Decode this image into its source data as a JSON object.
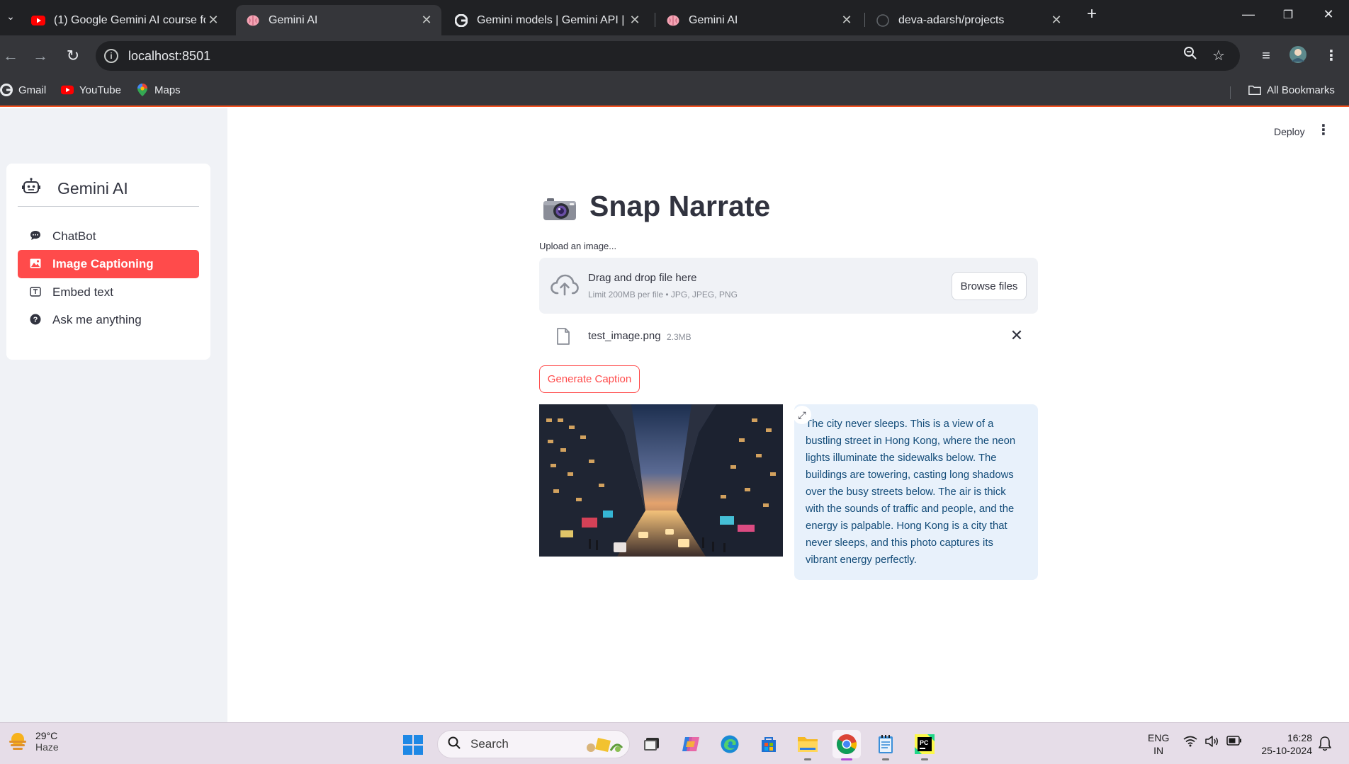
{
  "browser": {
    "tabs": [
      {
        "title": "(1) Google Gemini AI course for",
        "favicon": "youtube-icon",
        "active": false
      },
      {
        "title": "Gemini AI",
        "favicon": "brain-icon",
        "active": true
      },
      {
        "title": "Gemini models  |  Gemini API  |",
        "favicon": "google-icon",
        "active": false
      },
      {
        "title": "Gemini AI",
        "favicon": "brain-icon",
        "active": false
      },
      {
        "title": "deva-adarsh/projects",
        "favicon": "github-icon",
        "active": false
      }
    ],
    "url": "localhost:8501",
    "bookmarks": [
      {
        "label": "Gmail",
        "icon": "google-icon"
      },
      {
        "label": "YouTube",
        "icon": "youtube-icon"
      },
      {
        "label": "Maps",
        "icon": "maps-icon"
      }
    ],
    "all_bookmarks_label": "All Bookmarks"
  },
  "sidebar": {
    "brand": "Gemini AI",
    "items": [
      {
        "label": "ChatBot",
        "icon": "chat-bubble-icon",
        "active": false
      },
      {
        "label": "Image Captioning",
        "icon": "image-icon",
        "active": true
      },
      {
        "label": "Embed text",
        "icon": "textbox-icon",
        "active": false
      },
      {
        "label": "Ask me anything",
        "icon": "question-icon",
        "active": false
      }
    ]
  },
  "header": {
    "deploy_label": "Deploy"
  },
  "main": {
    "title": "Snap Narrate",
    "upload_label": "Upload an image...",
    "dropzone": {
      "primary": "Drag and drop file here",
      "secondary": "Limit 200MB per file • JPG, JPEG, PNG",
      "browse_label": "Browse files"
    },
    "file": {
      "name": "test_image.png",
      "size": "2.3MB"
    },
    "generate_label": "Generate Caption",
    "caption": "The city never sleeps. This is a view of a bustling street in Hong Kong, where the neon lights illuminate the sidewalks below. The buildings are towering, casting long shadows over the busy streets below. The air is thick with the sounds of traffic and people, and the energy is palpable. Hong Kong is a city that never sleeps, and this photo captures its vibrant energy perfectly."
  },
  "taskbar": {
    "weather": {
      "temp": "29°C",
      "condition": "Haze"
    },
    "search_label": "Search",
    "lang_line1": "ENG",
    "lang_line2": "IN",
    "time": "16:28",
    "date": "25-10-2024"
  },
  "colors": {
    "accent": "#ff4b4b",
    "sidebar_bg": "#f0f2f6",
    "caption_bg": "#e8f1fb",
    "caption_text": "#124b78"
  }
}
